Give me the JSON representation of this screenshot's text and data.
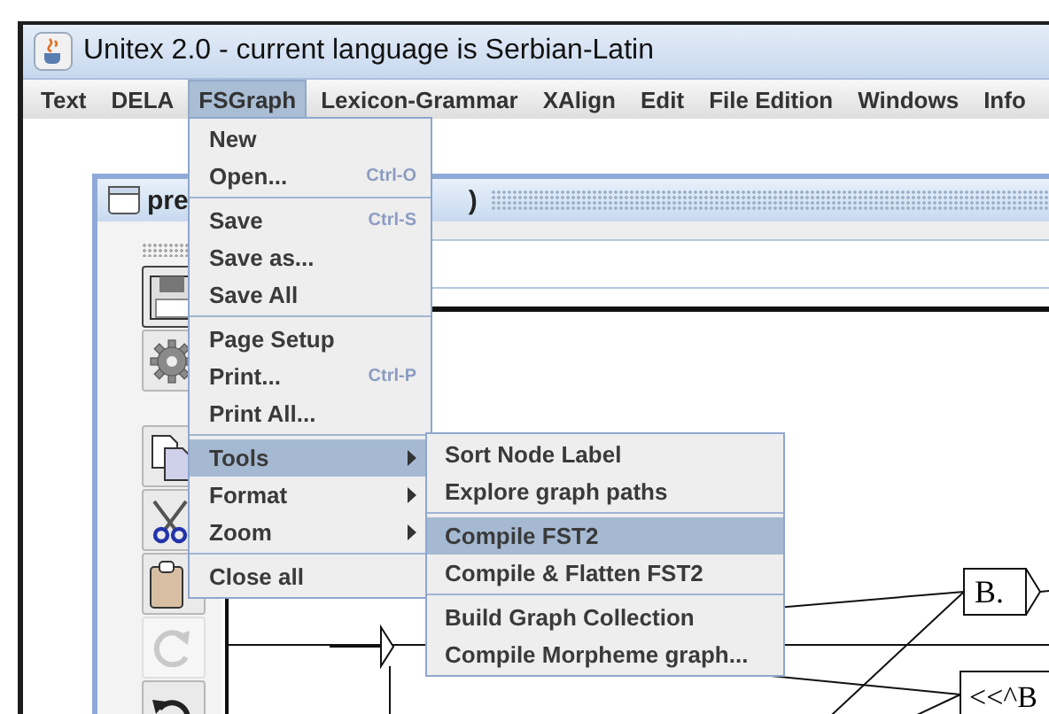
{
  "window": {
    "title": "Unitex 2.0 - current language is Serbian-Latin"
  },
  "menu_bar": [
    {
      "label": "Text",
      "selected": false
    },
    {
      "label": "DELA",
      "selected": false
    },
    {
      "label": "FSGraph",
      "selected": true
    },
    {
      "label": "Lexicon-Grammar",
      "selected": false
    },
    {
      "label": "XAlign",
      "selected": false
    },
    {
      "label": "Edit",
      "selected": false
    },
    {
      "label": "File Edition",
      "selected": false
    },
    {
      "label": "Windows",
      "selected": false
    },
    {
      "label": "Info",
      "selected": false
    }
  ],
  "fsgraph_menu": {
    "groups": [
      [
        {
          "label": "New",
          "selected": false,
          "submenu": false
        },
        {
          "label": "Open...",
          "shortcut": "Ctrl-O",
          "selected": false,
          "submenu": false
        }
      ],
      [
        {
          "label": "Save",
          "shortcut": "Ctrl-S",
          "selected": false,
          "submenu": false
        },
        {
          "label": "Save as...",
          "selected": false,
          "submenu": false
        },
        {
          "label": "Save All",
          "selected": false,
          "submenu": false
        }
      ],
      [
        {
          "label": "Page Setup",
          "selected": false,
          "submenu": false
        },
        {
          "label": "Print...",
          "shortcut": "Ctrl-P",
          "selected": false,
          "submenu": false
        },
        {
          "label": "Print All...",
          "selected": false,
          "submenu": false
        }
      ],
      [
        {
          "label": "Tools",
          "selected": true,
          "submenu": true
        },
        {
          "label": "Format",
          "selected": false,
          "submenu": true
        },
        {
          "label": "Zoom",
          "selected": false,
          "submenu": true
        }
      ],
      [
        {
          "label": "Close all",
          "selected": false,
          "submenu": false
        }
      ]
    ]
  },
  "tools_submenu": {
    "groups": [
      [
        {
          "label": "Sort Node Label",
          "selected": false
        },
        {
          "label": "Explore graph paths",
          "selected": false
        }
      ],
      [
        {
          "label": "Compile FST2",
          "selected": true
        },
        {
          "label": "Compile & Flatten FST2",
          "selected": false
        }
      ],
      [
        {
          "label": "Build Graph Collection",
          "selected": false
        },
        {
          "label": "Compile Morpheme graph...",
          "selected": false
        }
      ]
    ]
  },
  "graph_window": {
    "title_start": "pre",
    "title_end": ")",
    "toolbar": [
      {
        "kind": "save",
        "disabled": false
      },
      {
        "kind": "compile",
        "disabled": false
      },
      {
        "kind": "copy",
        "disabled": false
      },
      {
        "kind": "cut",
        "disabled": false
      },
      {
        "kind": "paste",
        "disabled": false
      },
      {
        "kind": "redo",
        "disabled": true
      },
      {
        "kind": "undo",
        "disabled": false
      }
    ]
  },
  "graph": {
    "nodes": [
      {
        "label": "B."
      },
      {
        "label": "<<^B"
      }
    ]
  }
}
